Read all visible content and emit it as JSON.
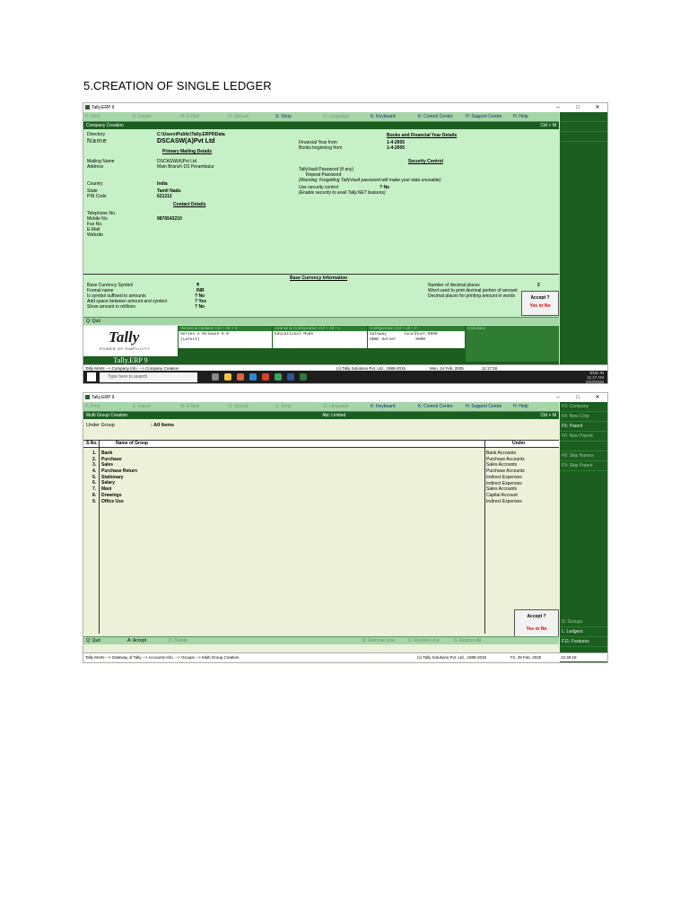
{
  "heading": "5.CREATION OF SINGLE LEDGER",
  "shot1": {
    "app_title": "Tally.ERP 9",
    "toolbar": [
      "P: Print",
      "E: Export",
      "M: E-Mail",
      "O: Upload",
      "S: Shop",
      "G: Language",
      "K: Keyboard",
      "K: Control Centre",
      "H: Support Centre",
      "H: Help"
    ],
    "header_left": "Company Creation",
    "header_right": "Ctrl + M",
    "labels": {
      "directory": "Directory",
      "name": "Name",
      "mailing_name": "Mailing Name",
      "address": "Address",
      "country": "Country",
      "state": "State",
      "pin": "PIN Code",
      "telephone": "Telephone No.",
      "mobile": "Mobile No.",
      "fax": "Fax No.",
      "email": "E-Mail",
      "website": "Website",
      "fy_from": "Financial Year from",
      "books_from": "Books beginning from",
      "vault_pwd": "TallyVault Password (if any)",
      "repeat_pwd": "Repeat Password",
      "vault_warning": "(Warning: Forgetting TallyVault password will make your data unusable)",
      "use_security": "Use security control",
      "enable_security": "(Enable security to avail Tally.NET features)",
      "base_symbol": "Base Currency Symbol",
      "formal_name": "Formal name",
      "suffixed": "Is symbol suffixed to amounts",
      "add_space": "Add space between amount and symbol",
      "millions": "Show amount in millions",
      "decimals": "Number of decimal places",
      "decimal_word": "Word used to print decimal portion of amount",
      "decimal_print": "Decimal places for printing amount in words"
    },
    "sections": {
      "primary": "Primary Mailing Details",
      "books": "Books and Financial Year Details",
      "security": "Security Control",
      "contact": "Contact Details",
      "currency": "Base Currency Information"
    },
    "values": {
      "directory": "C:\\Users\\Public\\Tally.ERP9\\Data",
      "name": "DSCASW(A)Pvt Ltd",
      "mailing_name": "DSCASW(A)Pvt Ltd",
      "address": "Main Branch DS Perambalur",
      "country": "India",
      "state": "Tamil Nadu",
      "pin": "621212",
      "mobile": "9876543210",
      "fy_from": "1-4-2005",
      "books_from": "1-4-2005",
      "use_security": "? No",
      "base_symbol": "₹",
      "formal_name": "INR",
      "suffixed": "? No",
      "add_space": "? Yes",
      "millions": "? No",
      "decimals": "2"
    },
    "accept": {
      "question": "Accept ?",
      "yn": "Yes or No"
    },
    "quit": "Q: Quit",
    "info": {
      "version_head": "Version & Updates    Ctrl + Alt + V",
      "version_body": "Series A Release 5.0\n(Latest)",
      "license_head": "License & Configuration    Ctrl + Alt + L",
      "license_body": "Educational Mode",
      "config_head": "Configuration    Ctrl + Alt + F",
      "config_body": "Gateway       localhost:9999\nODBC Server        9000",
      "calc_head": "Calculator",
      "logo_tag": "POWER OF SIMPLICITY",
      "logo_text": "Tally",
      "product": "Tally.ERP 9"
    },
    "status_left": "Tally MAIN --> Company Info. --> Company  Creation",
    "status_mid": "(c) Tally Solutions Pvt. Ltd., 1988-2015",
    "status_date": "Mon, 24 Feb, 2025",
    "status_time": "11:17:28",
    "taskbar_search": "Type here to search",
    "tray_time": "11:17 AM",
    "tray_date": "2/24/2025",
    "tray_lang": "ENG IN"
  },
  "shot2": {
    "app_title": "Tally.ERP 9",
    "header_left": "Multi Group  Creation",
    "header_mid": "Abc Limited",
    "header_right": "Ctrl + M",
    "under_label": "Under Group",
    "under_value": ": All Items",
    "col_sno": "S.No.",
    "col_name": "Name of Group",
    "col_under": "Under",
    "groups": [
      {
        "no": "1.",
        "name": "Bank",
        "under": "Bank Accounts"
      },
      {
        "no": "2.",
        "name": "Purchase",
        "under": "Purchase Accounts"
      },
      {
        "no": "3.",
        "name": "Sales",
        "under": "Sales Accounts"
      },
      {
        "no": "4.",
        "name": "Purchase Return",
        "under": "Purchase Accounts"
      },
      {
        "no": "5.",
        "name": "Stationary",
        "under": "Indirect Expenses"
      },
      {
        "no": "6.",
        "name": "Salary",
        "under": "Indirect Expenses"
      },
      {
        "no": "7.",
        "name": "Mani",
        "under": "Sales Accounts"
      },
      {
        "no": "8.",
        "name": "Drawings",
        "under": "Capital Account"
      },
      {
        "no": "9.",
        "name": "Office Use",
        "under": "Indirect Expenses"
      }
    ],
    "sidebar": [
      "F3: Company",
      "F4: New Cmp",
      "F5: Parent",
      "F6: New Parent",
      "",
      "F8: Skip Names",
      "F9: Skip Parent"
    ],
    "sidebar_bottom": [
      "G: Groups",
      "L: Ledgers",
      "F11: Features"
    ],
    "bottombar": [
      "Q: Quit",
      "A: Accept",
      "D: Delete",
      "R: Remove Line",
      "U: Restore Line",
      "S: Restore All"
    ],
    "accept": {
      "question": "Accept ?",
      "yn": "Yes or No"
    },
    "status_left": "Tally MAIN --> Gateway of Tally --> Accounts Info. --> Groups --> Multi Group  Creation",
    "status_mid": "(c) Tally Solutions Pvt. Ltd., 1988-2015",
    "status_date": "Fri, 28 Feb, 2025",
    "status_time": "12:48:18"
  }
}
